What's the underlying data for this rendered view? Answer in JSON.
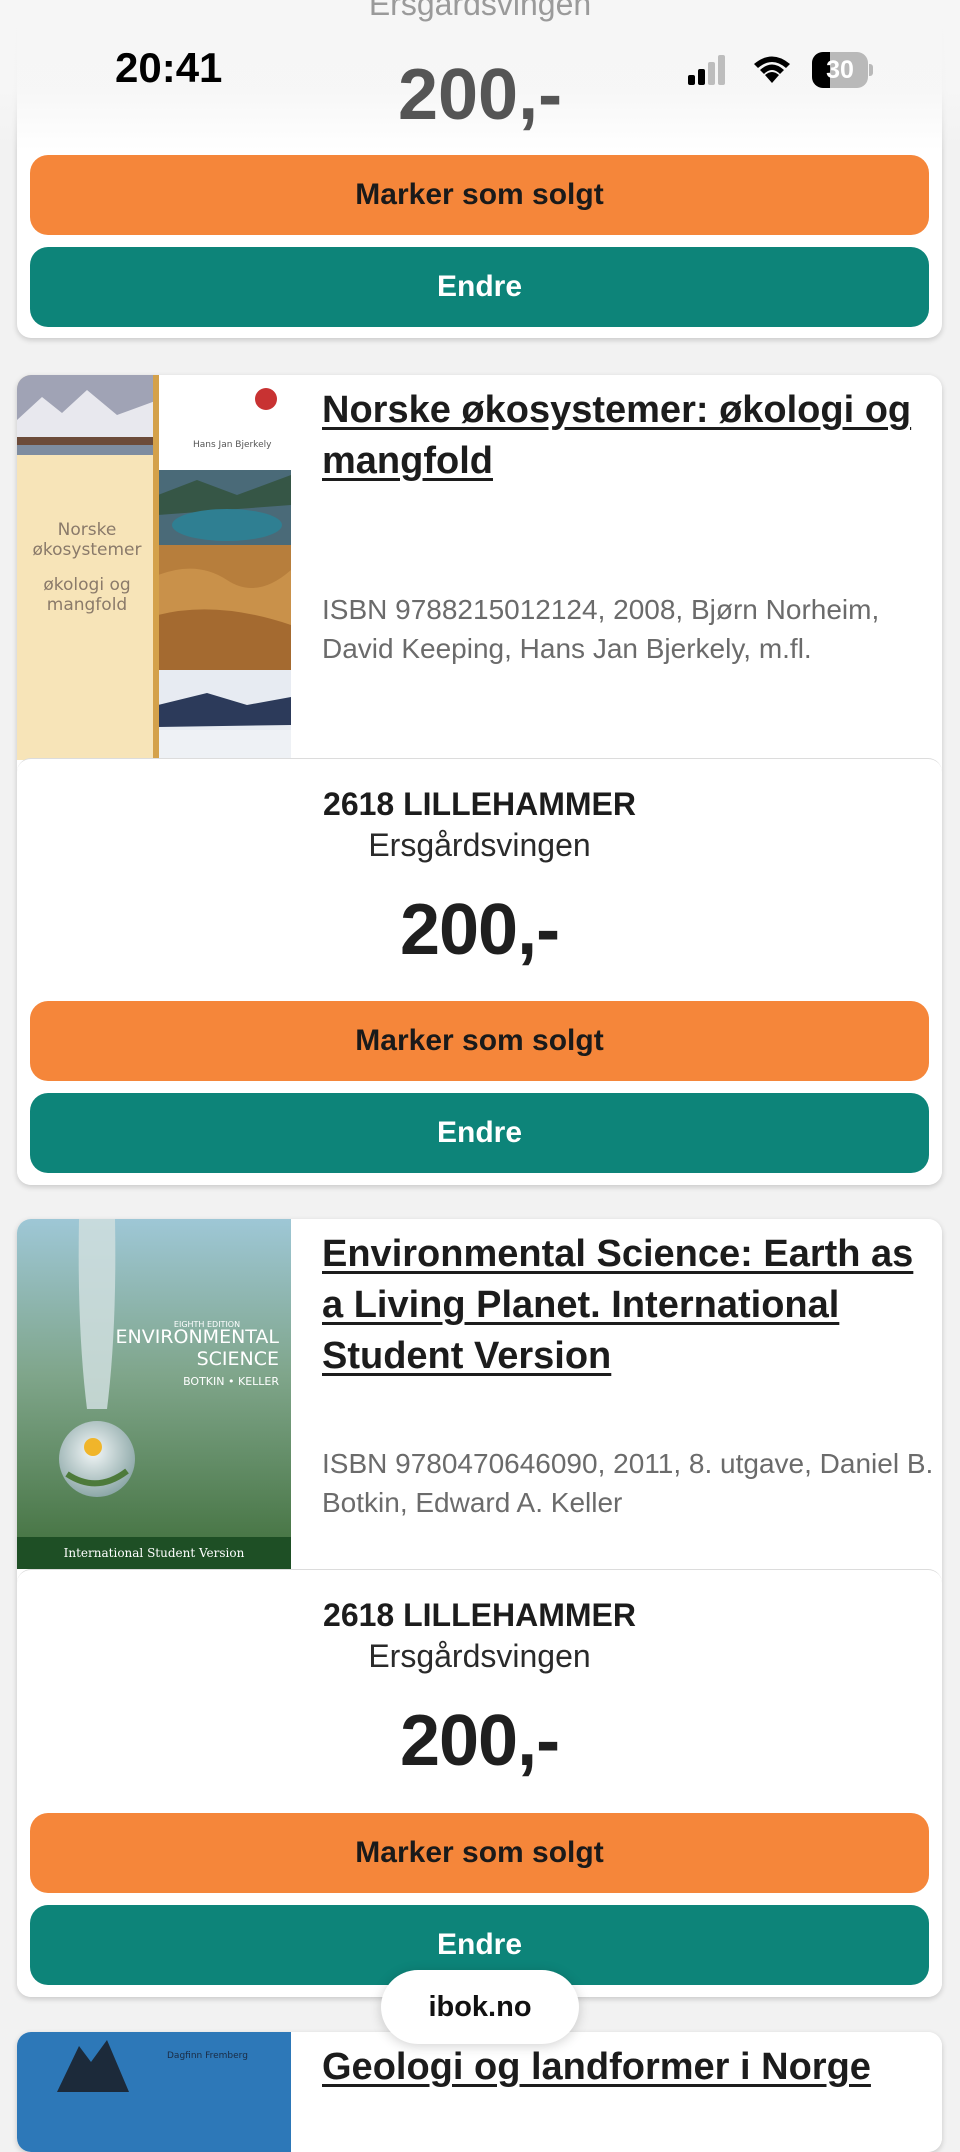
{
  "status": {
    "time": "20:41",
    "battery": "30",
    "icons": [
      "signal-icon",
      "wifi-icon",
      "battery-icon"
    ]
  },
  "partial_top_listing": {
    "street": "Ersgårdsvingen",
    "price": "200,-",
    "sold_label": "Marker som solgt",
    "edit_label": "Endre"
  },
  "listings": [
    {
      "title": "Norske økosystemer: økologi og mangfold",
      "meta": "ISBN 9788215012124, 2008, Bjørn Norheim, David Keeping, Hans Jan Bjerkely, m.fl.",
      "cover_text": {
        "author": "Hans Jan Bjerkely",
        "title": "Norske økosystemer økologi og mangfold"
      },
      "city": "2618 LILLEHAMMER",
      "street": "Ersgårdsvingen",
      "price": "200,-",
      "sold_label": "Marker som solgt",
      "edit_label": "Endre"
    },
    {
      "title": "Environmental Science: Earth as a Living Planet. International Student Version",
      "meta": "ISBN 9780470646090, 2011, 8. utgave, Daniel B. Botkin, Edward A. Keller",
      "cover_text": {
        "edition": "EIGHTH EDITION",
        "title_line1": "ENVIRONMENTAL",
        "title_line2": "SCIENCE",
        "authors": "BOTKIN • KELLER",
        "footer": "International Student Version"
      },
      "city": "2618 LILLEHAMMER",
      "street": "Ersgårdsvingen",
      "price": "200,-",
      "sold_label": "Marker som solgt",
      "edit_label": "Endre"
    },
    {
      "title": "Geologi og landformer i Norge",
      "cover_text": {
        "author": "Dagfinn Fremberg"
      }
    }
  ],
  "site": "ibok.no",
  "colors": {
    "orange": "#f5863a",
    "teal": "#0d8479",
    "background": "#f2f2f2"
  }
}
